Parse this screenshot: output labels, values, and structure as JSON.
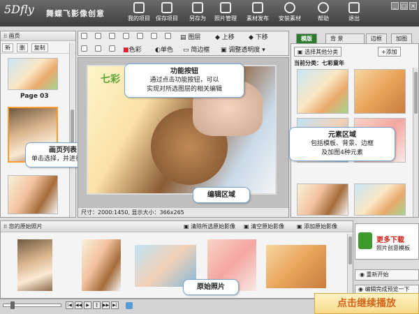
{
  "app": {
    "logo": "5Dfly",
    "name_cn": "舞蝶飞影像创意"
  },
  "toolbar": {
    "items": [
      {
        "label": "我的项目"
      },
      {
        "label": "保存项目"
      },
      {
        "label": "另存为"
      },
      {
        "label": "照片管理"
      },
      {
        "label": "素材发布"
      },
      {
        "label": "安装素材"
      },
      {
        "label": "帮助"
      },
      {
        "label": "退出"
      }
    ]
  },
  "left_panel": {
    "title": "画页",
    "buttons": [
      "新",
      "删",
      "复制"
    ],
    "page_label": "Page 03",
    "callout_title": "画页列表",
    "callout_text": "单击选择，并进行编辑"
  },
  "edit_toolbar": {
    "layer": "图层",
    "up": "上移",
    "down": "下移",
    "color": "色彩",
    "mono": "单色",
    "simple_frame": "简边框",
    "adjust_opacity": "调整透明度"
  },
  "canvas": {
    "size_label": "尺寸：2000:1450, 显示大小：366x265",
    "callout_func_title": "功能按钮",
    "callout_func_text1": "通过点击功能按钮，可以",
    "callout_func_text2": "实现对所选图层的相关编辑",
    "callout_edit": "编辑区域"
  },
  "right_panel": {
    "tabs": [
      "模版",
      "背 景",
      "边框",
      "加图"
    ],
    "select_btn": "选择其他分类",
    "add_btn": "+添加",
    "category": "当前分类：七彩童年",
    "callout_title": "元素区域",
    "callout_text1": "包括模板、背景、边框",
    "callout_text2": "及加图4种元素"
  },
  "bottom": {
    "title": "您的原始照片",
    "clear_selected": "清除所选原始影像",
    "clear_all": "清空原始影像",
    "add": "添加原始影像",
    "callout": "原始照片"
  },
  "side_actions": {
    "more_title": "更多下载",
    "more_sub": "照片创意模板",
    "restart": "重新开始",
    "preview": "编辑完成预览一下"
  },
  "footer": {
    "continue": "点击继续播放"
  }
}
